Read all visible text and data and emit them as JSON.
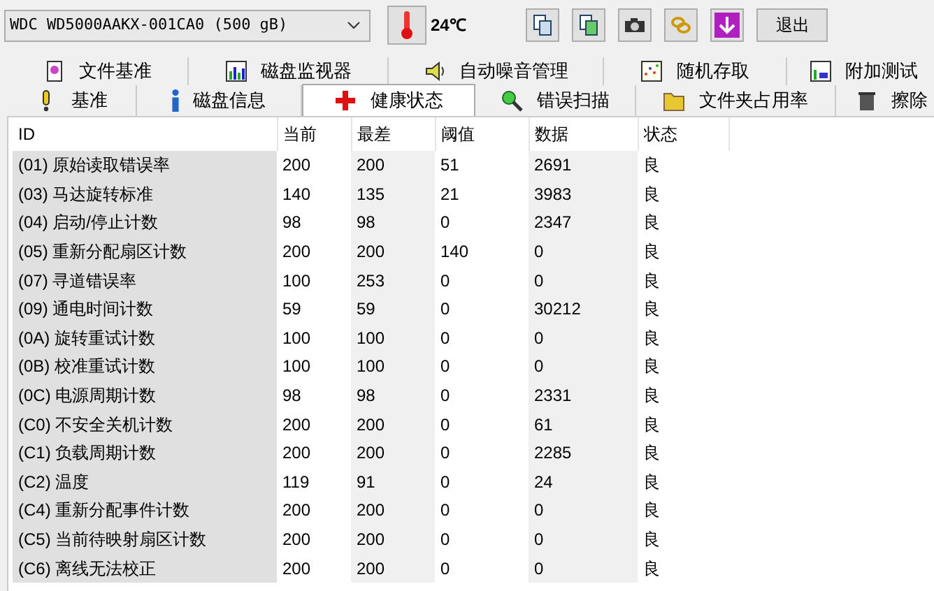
{
  "toolbar": {
    "drive": "WDC WD5000AAKX-001CA0 (500 gB)",
    "temperature": "24℃",
    "exit_button": "退出"
  },
  "tabs_row_1": [
    {
      "label": "文件基准"
    },
    {
      "label": "磁盘监视器"
    },
    {
      "label": "自动噪音管理"
    },
    {
      "label": "随机存取"
    },
    {
      "label": "附加测试"
    }
  ],
  "tabs_row_2": [
    {
      "label": "基准",
      "selected": false
    },
    {
      "label": "磁盘信息",
      "selected": false
    },
    {
      "label": "健康状态",
      "selected": true
    },
    {
      "label": "错误扫描",
      "selected": false
    },
    {
      "label": "文件夹占用率",
      "selected": false
    },
    {
      "label": "擦除",
      "selected": false
    }
  ],
  "table": {
    "columns": [
      "ID",
      "当前",
      "最差",
      "阈值",
      "数据",
      "状态"
    ],
    "rows": [
      [
        "(01) 原始读取错误率",
        "200",
        "200",
        "51",
        "2691",
        "良"
      ],
      [
        "(03) 马达旋转标准",
        "140",
        "135",
        "21",
        "3983",
        "良"
      ],
      [
        "(04) 启动/停止计数",
        "98",
        "98",
        "0",
        "2347",
        "良"
      ],
      [
        "(05) 重新分配扇区计数",
        "200",
        "200",
        "140",
        "0",
        "良"
      ],
      [
        "(07) 寻道错误率",
        "100",
        "253",
        "0",
        "0",
        "良"
      ],
      [
        "(09) 通电时间计数",
        "59",
        "59",
        "0",
        "30212",
        "良"
      ],
      [
        "(0A) 旋转重试计数",
        "100",
        "100",
        "0",
        "0",
        "良"
      ],
      [
        "(0B) 校准重试计数",
        "100",
        "100",
        "0",
        "0",
        "良"
      ],
      [
        "(0C) 电源周期计数",
        "98",
        "98",
        "0",
        "2331",
        "良"
      ],
      [
        "(C0) 不安全关机计数",
        "200",
        "200",
        "0",
        "61",
        "良"
      ],
      [
        "(C1) 负载周期计数",
        "200",
        "200",
        "0",
        "2285",
        "良"
      ],
      [
        "(C2) 温度",
        "119",
        "91",
        "0",
        "24",
        "良"
      ],
      [
        "(C4) 重新分配事件计数",
        "200",
        "200",
        "0",
        "0",
        "良"
      ],
      [
        "(C5) 当前待映射扇区计数",
        "200",
        "200",
        "0",
        "0",
        "良"
      ],
      [
        "(C6) 离线无法校正",
        "200",
        "200",
        "0",
        "0",
        "良"
      ]
    ]
  }
}
